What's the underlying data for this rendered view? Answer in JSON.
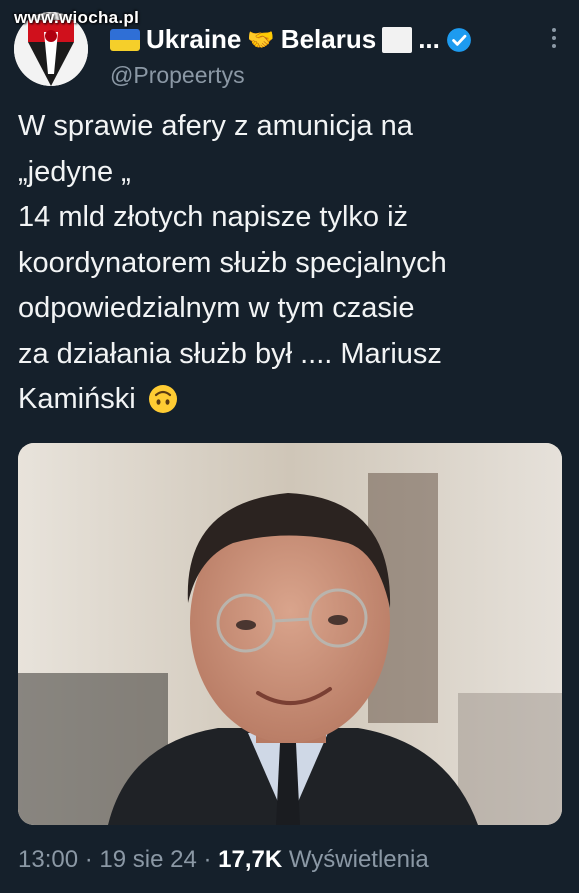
{
  "watermark": "www.wiocha.pl",
  "author": {
    "display_name_part1": "Ukraine",
    "display_name_part2": "Belarus",
    "ellipsis": "...",
    "handle": "@Propeertys"
  },
  "tweet": {
    "lines": [
      "W sprawie afery z amunicja na",
      "„jedyne „",
      "14 mld złotych napisze tylko iż",
      "koordynatorem służb specjalnych",
      "odpowiedzialnym w tym czasie",
      "za działania służb był .... Mariusz",
      "Kamiński"
    ]
  },
  "meta": {
    "time": "13:00",
    "sep1": " · ",
    "date": "19 sie 24",
    "sep2": " · ",
    "views_count": "17,7K",
    "views_label": " Wyświetlenia"
  },
  "colors": {
    "background": "#15202b",
    "secondary_text": "#8b98a5",
    "verified_blue": "#1d9bf0"
  }
}
